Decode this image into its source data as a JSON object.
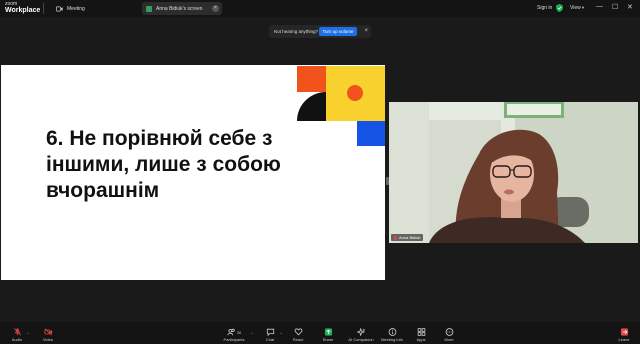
{
  "app": {
    "logo_line1": "zoom",
    "logo_line2": "Workplace"
  },
  "tabs": [
    {
      "label": "Meeting"
    },
    {
      "label": "Anna Bidiuk's screen"
    }
  ],
  "header": {
    "sign_in": "Sign in",
    "view": "View"
  },
  "notice": {
    "text": "Not hearing anything?",
    "button": "Turn up volume",
    "close": "×"
  },
  "slide": {
    "title": "6. Не порівнюй себе з іншими, лише з собою вчорашнім"
  },
  "participant": {
    "name": "Anna Bidiuk"
  },
  "toolbar": {
    "audio": "Audio",
    "video": "Video",
    "participants": "Participants",
    "participant_count": "30",
    "chat": "Chat",
    "react": "React",
    "share": "Share",
    "ai_companion": "AI Companion",
    "meeting_info": "Meeting info",
    "apps": "Apps",
    "more": "More",
    "leave": "Leave"
  },
  "colors": {
    "accent_blue": "#1f6fe5",
    "shape_orange": "#f2521c",
    "shape_yellow": "#f8d12f",
    "shape_blue": "#1654e6",
    "share_green": "#20b05a",
    "leave_red": "#e04848"
  }
}
